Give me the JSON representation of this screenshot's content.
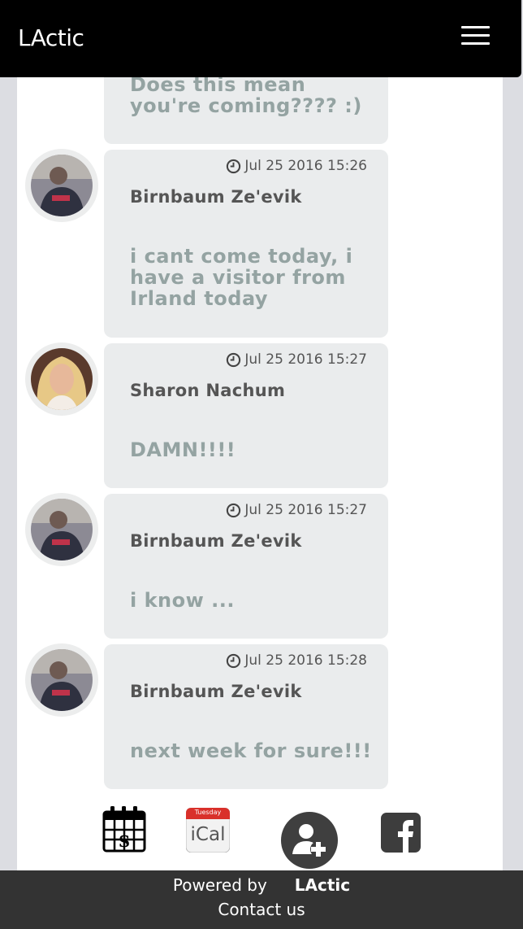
{
  "header": {
    "brand": "LActic",
    "menu_icon": "hamburger-menu-icon"
  },
  "messages": [
    {
      "time": "",
      "author": "",
      "body": "Does this mean you're coming???? :)"
    },
    {
      "time": "Jul 25 2016 15:26",
      "author": "Birnbaum Ze'evik",
      "body": "i cant come today, i have a visitor from Irland today"
    },
    {
      "time": "Jul 25 2016 15:27",
      "author": "Sharon Nachum",
      "body": "DAMN!!!!"
    },
    {
      "time": "Jul 25 2016 15:27",
      "author": "Birnbaum Ze'evik",
      "body": "i know ..."
    },
    {
      "time": "Jul 25 2016 15:28",
      "author": "Birnbaum Ze'evik",
      "body": "next week for sure!!!"
    }
  ],
  "actions": {
    "calendar_icon": "calendar-icon",
    "ical": {
      "day": "Tuesday",
      "label": "iCal"
    },
    "add_user_icon": "add-user-icon",
    "facebook_icon": "facebook-icon"
  },
  "footer": {
    "powered_by": "Powered by",
    "brand": "LActic",
    "contact": "Contact us"
  },
  "colors": {
    "header_bg": "#000000",
    "bubble_bg": "#eaeced",
    "body_text": "#94a3a2",
    "footer_bg": "#333333"
  }
}
